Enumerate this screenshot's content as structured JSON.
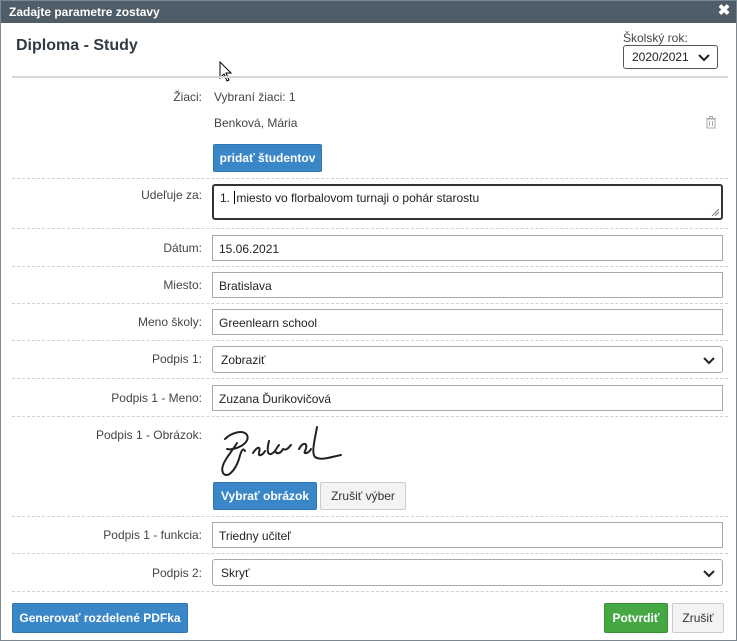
{
  "dialog": {
    "title": "Zadajte parametre zostavy",
    "close_icon": "close-icon"
  },
  "report": {
    "title": "Diploma - Study"
  },
  "school_year": {
    "label": "Školský rok:",
    "value": "2020/2021"
  },
  "students": {
    "label": "Žiaci:",
    "selected_text": "Vybraní žiaci: 1",
    "list": [
      "Benková, Mária"
    ],
    "add_button": "pridať študentov"
  },
  "awarded_for": {
    "label": "Udeľuje za:",
    "value_before_caret": "1. ",
    "value_after_caret": "miesto vo florbalovom turnaji o pohár starostu"
  },
  "date": {
    "label": "Dátum:",
    "value": "15.06.2021"
  },
  "place": {
    "label": "Miesto:",
    "value": "Bratislava"
  },
  "school_name": {
    "label": "Meno školy:",
    "value": "Greenlearn school"
  },
  "signature1": {
    "label": "Podpis 1:",
    "value": "Zobraziť",
    "name_label": "Podpis 1 - Meno:",
    "name_value": "Zuzana Ďurikovičová",
    "image_label": "Podpis 1 - Obrázok:",
    "choose_image_button": "Vybrať obrázok",
    "clear_selection_button": "Zrušiť výber",
    "function_label": "Podpis 1 - funkcia:",
    "function_value": "Triedny učiteľ"
  },
  "signature2": {
    "label": "Podpis 2:",
    "value": "Skryť"
  },
  "footer": {
    "generate_button": "Generovať rozdelené PDFka",
    "confirm_button": "Potvrdiť",
    "cancel_button": "Zrušiť"
  },
  "colors": {
    "titlebar": "#4f5d68",
    "primary": "#3a87c8",
    "success": "#45a845"
  }
}
